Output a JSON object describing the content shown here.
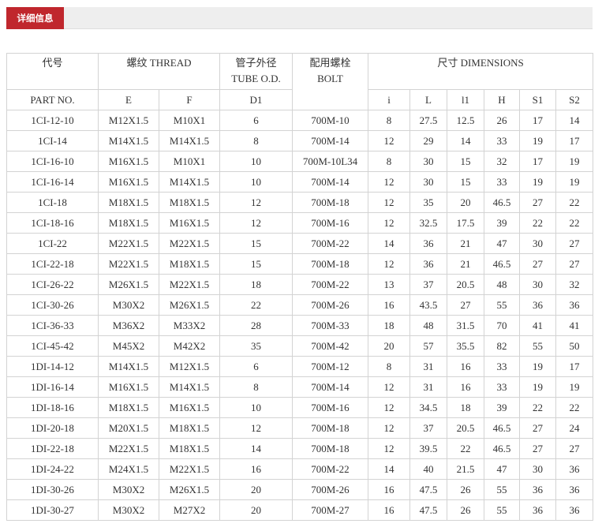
{
  "tab": {
    "label": "详细信息"
  },
  "header": {
    "code": "代号",
    "thread": "螺纹 THREAD",
    "tube_cn": "管子外径",
    "tube_en": "TUBE O.D.",
    "bolt_cn": "配用螺栓",
    "bolt_en": "BOLT",
    "dimensions": "尺寸 DIMENSIONS",
    "part_no": "PART NO.",
    "e": "E",
    "f": "F",
    "d1": "D1",
    "i": "i",
    "l": "L",
    "l1": "l1",
    "h": "H",
    "s1": "S1",
    "s2": "S2"
  },
  "rows": [
    [
      "1CI-12-10",
      "M12X1.5",
      "M10X1",
      "6",
      "700M-10",
      "8",
      "27.5",
      "12.5",
      "26",
      "17",
      "14"
    ],
    [
      "1CI-14",
      "M14X1.5",
      "M14X1.5",
      "8",
      "700M-14",
      "12",
      "29",
      "14",
      "33",
      "19",
      "17"
    ],
    [
      "1CI-16-10",
      "M16X1.5",
      "M10X1",
      "10",
      "700M-10L34",
      "8",
      "30",
      "15",
      "32",
      "17",
      "19"
    ],
    [
      "1CI-16-14",
      "M16X1.5",
      "M14X1.5",
      "10",
      "700M-14",
      "12",
      "30",
      "15",
      "33",
      "19",
      "19"
    ],
    [
      "1CI-18",
      "M18X1.5",
      "M18X1.5",
      "12",
      "700M-18",
      "12",
      "35",
      "20",
      "46.5",
      "27",
      "22"
    ],
    [
      "1CI-18-16",
      "M18X1.5",
      "M16X1.5",
      "12",
      "700M-16",
      "12",
      "32.5",
      "17.5",
      "39",
      "22",
      "22"
    ],
    [
      "1CI-22",
      "M22X1.5",
      "M22X1.5",
      "15",
      "700M-22",
      "14",
      "36",
      "21",
      "47",
      "30",
      "27"
    ],
    [
      "1CI-22-18",
      "M22X1.5",
      "M18X1.5",
      "15",
      "700M-18",
      "12",
      "36",
      "21",
      "46.5",
      "27",
      "27"
    ],
    [
      "1CI-26-22",
      "M26X1.5",
      "M22X1.5",
      "18",
      "700M-22",
      "13",
      "37",
      "20.5",
      "48",
      "30",
      "32"
    ],
    [
      "1CI-30-26",
      "M30X2",
      "M26X1.5",
      "22",
      "700M-26",
      "16",
      "43.5",
      "27",
      "55",
      "36",
      "36"
    ],
    [
      "1CI-36-33",
      "M36X2",
      "M33X2",
      "28",
      "700M-33",
      "18",
      "48",
      "31.5",
      "70",
      "41",
      "41"
    ],
    [
      "1CI-45-42",
      "M45X2",
      "M42X2",
      "35",
      "700M-42",
      "20",
      "57",
      "35.5",
      "82",
      "55",
      "50"
    ],
    [
      "1DI-14-12",
      "M14X1.5",
      "M12X1.5",
      "6",
      "700M-12",
      "8",
      "31",
      "16",
      "33",
      "19",
      "17"
    ],
    [
      "1DI-16-14",
      "M16X1.5",
      "M14X1.5",
      "8",
      "700M-14",
      "12",
      "31",
      "16",
      "33",
      "19",
      "19"
    ],
    [
      "1DI-18-16",
      "M18X1.5",
      "M16X1.5",
      "10",
      "700M-16",
      "12",
      "34.5",
      "18",
      "39",
      "22",
      "22"
    ],
    [
      "1DI-20-18",
      "M20X1.5",
      "M18X1.5",
      "12",
      "700M-18",
      "12",
      "37",
      "20.5",
      "46.5",
      "27",
      "24"
    ],
    [
      "1DI-22-18",
      "M22X1.5",
      "M18X1.5",
      "14",
      "700M-18",
      "12",
      "39.5",
      "22",
      "46.5",
      "27",
      "27"
    ],
    [
      "1DI-24-22",
      "M24X1.5",
      "M22X1.5",
      "16",
      "700M-22",
      "14",
      "40",
      "21.5",
      "47",
      "30",
      "36"
    ],
    [
      "1DI-30-26",
      "M30X2",
      "M26X1.5",
      "20",
      "700M-26",
      "16",
      "47.5",
      "26",
      "55",
      "36",
      "36"
    ],
    [
      "1DI-30-27",
      "M30X2",
      "M27X2",
      "20",
      "700M-27",
      "16",
      "47.5",
      "26",
      "55",
      "36",
      "36"
    ]
  ]
}
